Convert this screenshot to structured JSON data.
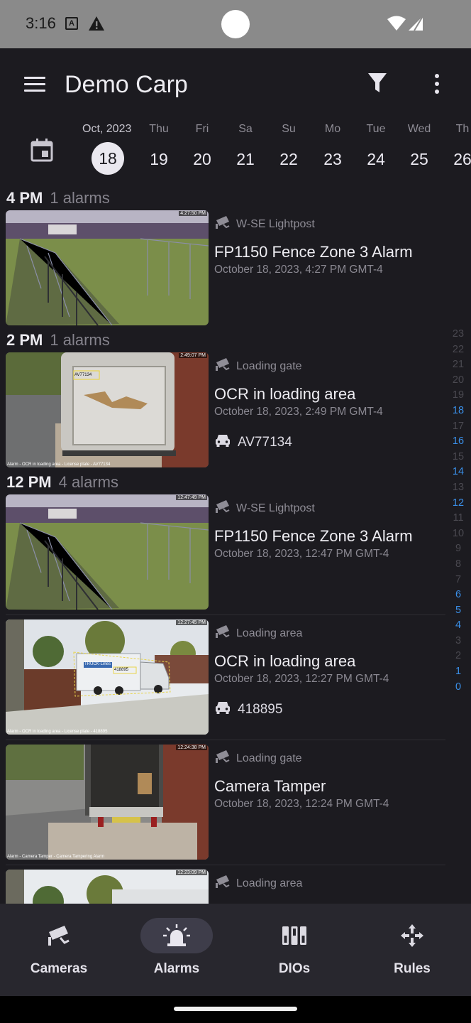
{
  "status_bar": {
    "time": "3:16",
    "a_badge": "A"
  },
  "appbar": {
    "title": "Demo Carp"
  },
  "date_strip": {
    "month_label": "Oct, 2023",
    "days": [
      {
        "dow": "",
        "num": "18",
        "selected": true
      },
      {
        "dow": "Thu",
        "num": "19"
      },
      {
        "dow": "Fri",
        "num": "20"
      },
      {
        "dow": "Sa",
        "num": "21"
      },
      {
        "dow": "Su",
        "num": "22"
      },
      {
        "dow": "Mo",
        "num": "23"
      },
      {
        "dow": "Tue",
        "num": "24"
      },
      {
        "dow": "Wed",
        "num": "25"
      },
      {
        "dow": "Th",
        "num": "26"
      }
    ]
  },
  "sections": [
    {
      "hour": "4 PM",
      "count": "1 alarms"
    },
    {
      "hour": "2 PM",
      "count": "1 alarms"
    },
    {
      "hour": "12 PM",
      "count": "4 alarms"
    }
  ],
  "alarms": [
    {
      "camera": "W-SE Lightpost",
      "title": "FP1150 Fence Zone 3 Alarm",
      "date": "October 18, 2023, 4:27 PM GMT-4",
      "stamp": "4:27:50 PM",
      "caption": "",
      "plate": ""
    },
    {
      "camera": "Loading gate",
      "title": "OCR in loading area",
      "date": "October 18, 2023, 2:49 PM GMT-4",
      "stamp": "2:49:07 PM",
      "caption": "Alarm - OCR in loading area - License plate - AV77134",
      "plate": "AV77134"
    },
    {
      "camera": "W-SE Lightpost",
      "title": "FP1150 Fence Zone 3 Alarm",
      "date": "October 18, 2023, 12:47 PM GMT-4",
      "stamp": "12:47:49 PM",
      "caption": "",
      "plate": ""
    },
    {
      "camera": "Loading area",
      "title": "OCR in loading area",
      "date": "October 18, 2023, 12:27 PM GMT-4",
      "stamp": "12:27:45 PM",
      "caption": "Alarm - OCR in loading area - License plate - 418895",
      "plate": "418895"
    },
    {
      "camera": "Loading gate",
      "title": "Camera Tamper",
      "date": "October 18, 2023, 12:24 PM GMT-4",
      "stamp": "12:24:38 PM",
      "caption": "Alarm - Camera Tamper - Camera Tampering Alarm",
      "plate": ""
    },
    {
      "camera": "Loading area",
      "title": "",
      "date": "",
      "stamp": "12:23:09 PM",
      "caption": "",
      "plate": ""
    }
  ],
  "thumb_labels": {
    "plate_box_1": "AV77134",
    "plate_box_2": "418895",
    "truck_logo": "TRUCK-Lines"
  },
  "scroller": {
    "items": [
      "23",
      "22",
      "21",
      "20",
      "19",
      "18",
      "17",
      "16",
      "15",
      "14",
      "13",
      "12",
      "11",
      "10",
      "9",
      "8",
      "7",
      "6",
      "5",
      "4",
      "3",
      "2",
      "1",
      "0"
    ],
    "active": [
      "18",
      "16",
      "14",
      "12",
      "6",
      "5",
      "4",
      "1",
      "0"
    ]
  },
  "bottom_nav": [
    {
      "label": "Cameras",
      "icon": "cctv-camera-icon",
      "active": false
    },
    {
      "label": "Alarms",
      "icon": "siren-icon",
      "active": true
    },
    {
      "label": "DIOs",
      "icon": "dio-icon",
      "active": false
    },
    {
      "label": "Rules",
      "icon": "rules-move-icon",
      "active": false
    }
  ],
  "colors": {
    "background": "#1c1b20",
    "accent_blue": "#3a8fe8",
    "nav_bg": "#28272e",
    "active_pill": "#3e3d4a"
  }
}
